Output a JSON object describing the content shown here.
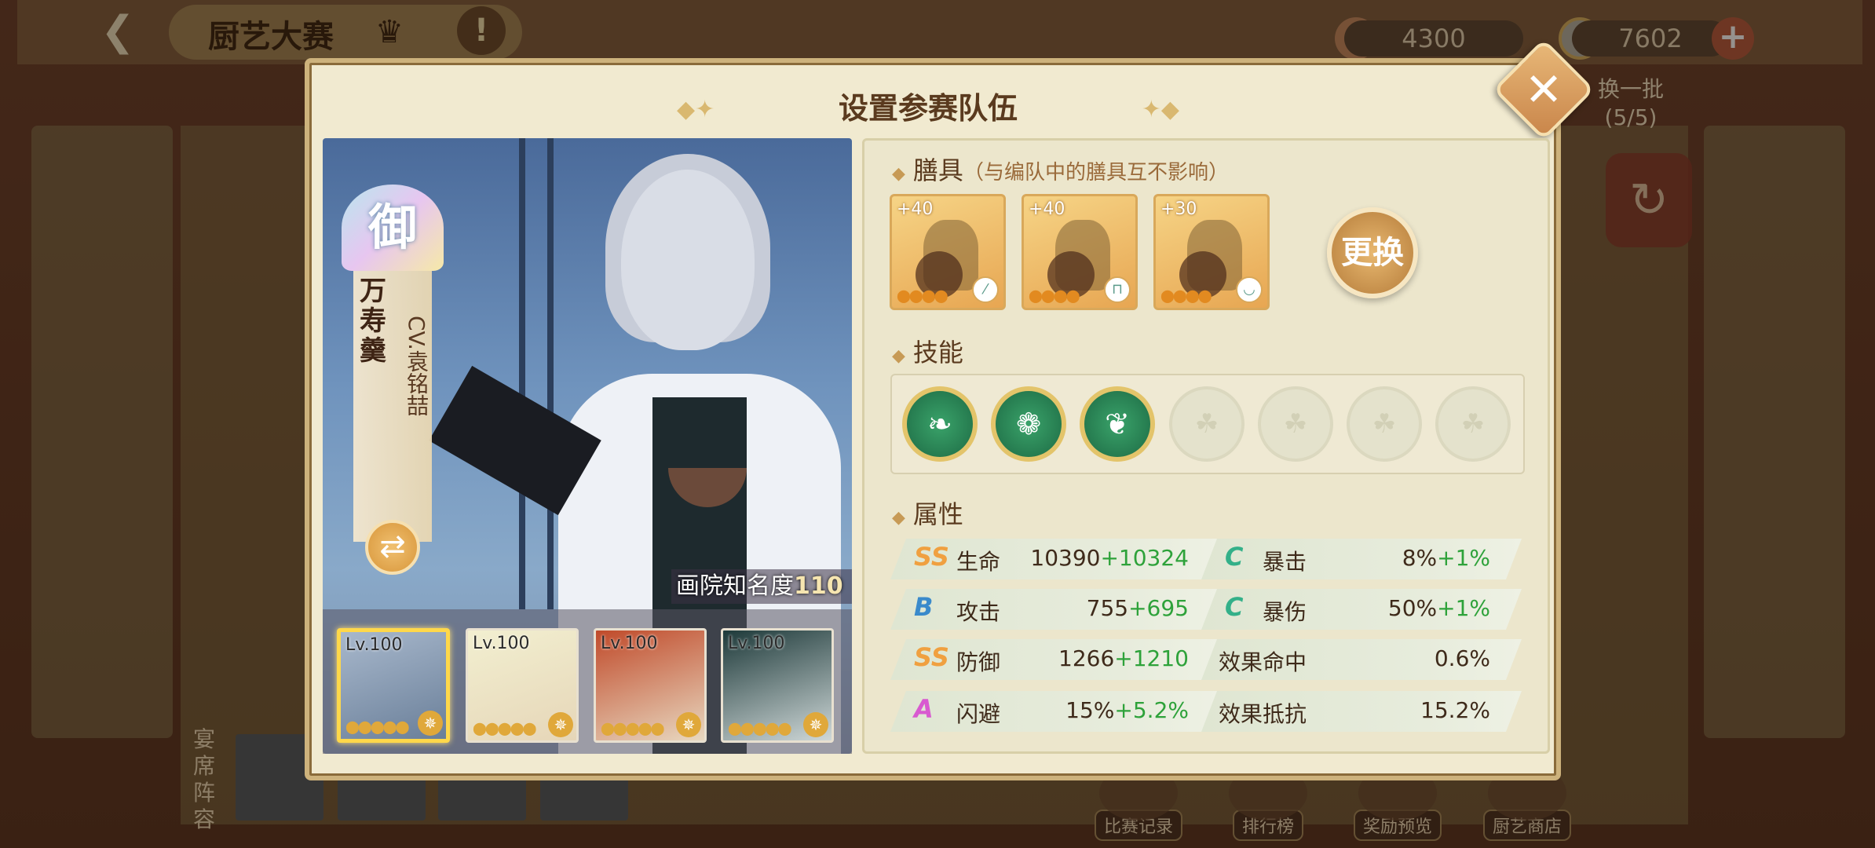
{
  "background": {
    "game_title": "厨艺大赛",
    "currency1": "4300",
    "currency2": "7602",
    "swap_label": "换一批",
    "swap_count": "(5/5)",
    "lineup_label": "宴席阵容",
    "bottom_buttons": [
      "比赛记录",
      "排行榜",
      "奖励预览",
      "厨艺商店"
    ]
  },
  "modal": {
    "title": "设置参赛队伍"
  },
  "character": {
    "rank": "御",
    "name": "万寿羹",
    "cv": "CV.袁铭喆",
    "fame_label": "画院知名度",
    "fame_value": "110"
  },
  "team": [
    {
      "level": "Lv.100",
      "selected": true
    },
    {
      "level": "Lv.100",
      "selected": false
    },
    {
      "level": "Lv.100",
      "selected": false
    },
    {
      "level": "Lv.100",
      "selected": false
    }
  ],
  "tools": {
    "header": "膳具",
    "note": "（与编队中的膳具互不影响）",
    "items": [
      {
        "plus": "+40",
        "type_icon": "spoon-icon"
      },
      {
        "plus": "+40",
        "type_icon": "pot-icon"
      },
      {
        "plus": "+30",
        "type_icon": "bowl-icon"
      }
    ],
    "change_label": "更换"
  },
  "skills": {
    "header": "技能",
    "unlocked": 3,
    "total": 7
  },
  "attributes": {
    "header": "属性",
    "rows": [
      {
        "grade": "SS",
        "label": "生命",
        "value": "10390",
        "bonus": "+10324"
      },
      {
        "grade": "C",
        "label": "暴击",
        "value": "8%",
        "bonus": "+1%"
      },
      {
        "grade": "B",
        "label": "攻击",
        "value": "755",
        "bonus": "+695"
      },
      {
        "grade": "C",
        "label": "暴伤",
        "value": "50%",
        "bonus": "+1%"
      },
      {
        "grade": "SS",
        "label": "防御",
        "value": "1266",
        "bonus": "+1210"
      },
      {
        "grade": "",
        "label": "效果命中",
        "value": "0.6%",
        "bonus": ""
      },
      {
        "grade": "A",
        "label": "闪避",
        "value": "15%",
        "bonus": "+5.2%"
      },
      {
        "grade": "",
        "label": "效果抵抗",
        "value": "15.2%",
        "bonus": ""
      }
    ]
  },
  "colors": {
    "bonus": "#2ea23a",
    "accent": "#c79a55"
  }
}
